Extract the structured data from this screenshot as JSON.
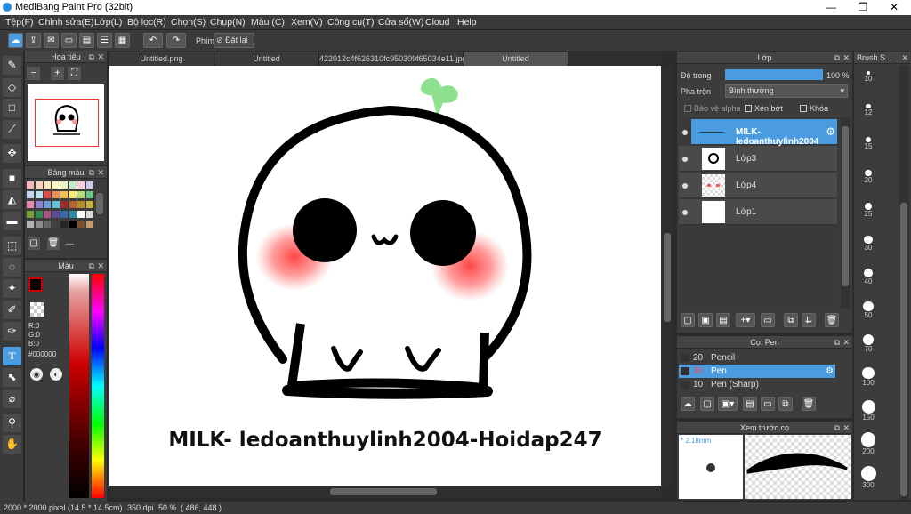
{
  "window": {
    "title": "MediBang Paint Pro (32bit)",
    "minimize": "—",
    "maximize": "❐",
    "close": "✕"
  },
  "menu": [
    "Tệp(F)",
    "Chỉnh sửa(E)",
    "Lớp(L)",
    "Bộ lọc(R)",
    "Chọn(S)",
    "Chụp(N)",
    "Màu (C)",
    "Xem(V)",
    "Công cụ(T)",
    "Cửa sổ(W)",
    "Cloud",
    "Help"
  ],
  "toolbar": {
    "phim_label": "Phím",
    "reset_label": "Đặt lại"
  },
  "tabs": [
    "Untitled.png",
    "Untitled",
    "422012c4f626310fc950309f65034e11.jpg",
    "Untitled"
  ],
  "navigator": {
    "title": "Hoa tiêu"
  },
  "palette": {
    "title": "Bảng màu",
    "swatch_colors": [
      "#f2b8b8",
      "#f7d2c0",
      "#f9e6bd",
      "#fff6c2",
      "#e9f5c2",
      "#c6ebc9",
      "#f7cfe0",
      "#d0c6ea",
      "#c4d8f0",
      "#b8e3ef",
      "#e34a4a",
      "#ee8f52",
      "#f2c14e",
      "#fbec73",
      "#b8dd72",
      "#6cc581",
      "#e88bb4",
      "#8f7fcc",
      "#6f9bd9",
      "#5ec2d9",
      "#9c2b2b",
      "#b46228",
      "#b88a22",
      "#c5b63b",
      "#76a03b",
      "#2f8a4e",
      "#a85386",
      "#5c4a99",
      "#3a67a8",
      "#2d8ba3",
      "#ffffff",
      "#d9d9d9",
      "#b3b3b3",
      "#8c8c8c",
      "#666666",
      "#404040",
      "#262626",
      "#000000",
      "#7a5230",
      "#c29b6a"
    ],
    "more": "---"
  },
  "color": {
    "title": "Màu",
    "r": "R:0",
    "g": "G:0",
    "b": "B:0",
    "hex": "#000000"
  },
  "canvas": {
    "caption": "MILK- ledoanthuylinh2004-Hoidap247"
  },
  "layers": {
    "title": "Lớp",
    "opacity_label": "Độ trong",
    "opacity_value": "100 %",
    "blend_label": "Pha trộn",
    "blend_value": "Bình thường",
    "protect_alpha": "Bảo vệ alpha",
    "clipping": "Xén bớt",
    "lock": "Khóa",
    "items": [
      {
        "name": "MILK- ledoanthuylinh2004",
        "selected": true
      },
      {
        "name": "Lớp3",
        "selected": false
      },
      {
        "name": "Lớp4",
        "selected": false
      },
      {
        "name": "Lớp1",
        "selected": false
      }
    ]
  },
  "brush": {
    "title": "Cọ: Pen",
    "items": [
      {
        "size": "20",
        "name": "Pencil",
        "selected": false
      },
      {
        "size": "30",
        "name": "Pen",
        "selected": true
      },
      {
        "size": "10",
        "name": "Pen (Sharp)",
        "selected": false
      }
    ]
  },
  "preview": {
    "title": "Xem trước cọ",
    "size": "* 2.18mm"
  },
  "brushsize": {
    "title": "Brush S...",
    "sizes": [
      "10",
      "12",
      "15",
      "20",
      "25",
      "30",
      "40",
      "50",
      "70",
      "100",
      "150",
      "200",
      "300"
    ]
  },
  "status": {
    "dims": "2000 * 2000 pixel",
    "cm": "(14.5 * 14.5cm)",
    "dpi": "350 dpi",
    "zoom": "50 %",
    "coord": "( 486, 448 )"
  }
}
